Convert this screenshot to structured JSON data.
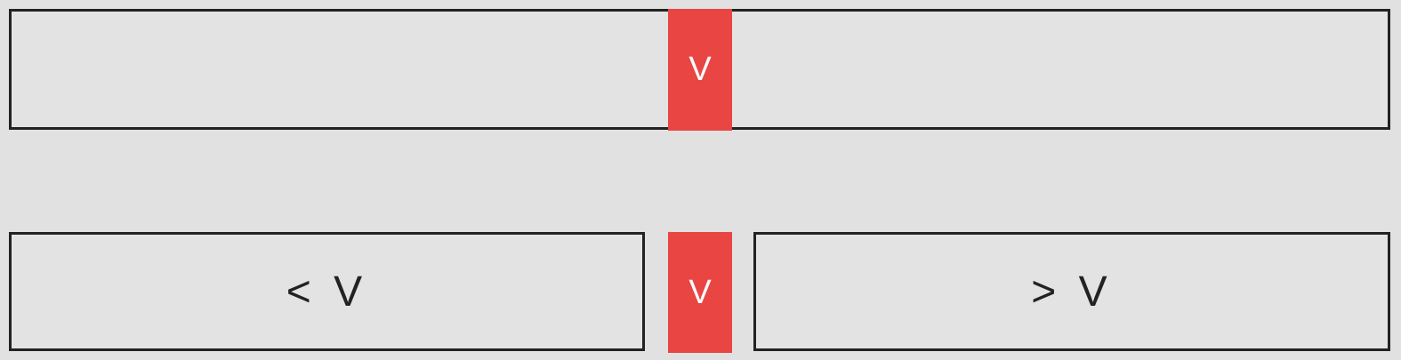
{
  "colors": {
    "background": "#e1e1e1",
    "box_fill": "#e3e3e3",
    "box_border": "#222222",
    "pivot": "#e84543",
    "pivot_text": "#ffffff",
    "label_text": "#222222"
  },
  "top_row": {
    "pivot_label": "V"
  },
  "bottom_row": {
    "left_label": "< V",
    "pivot_label": "V",
    "right_label": "> V"
  }
}
